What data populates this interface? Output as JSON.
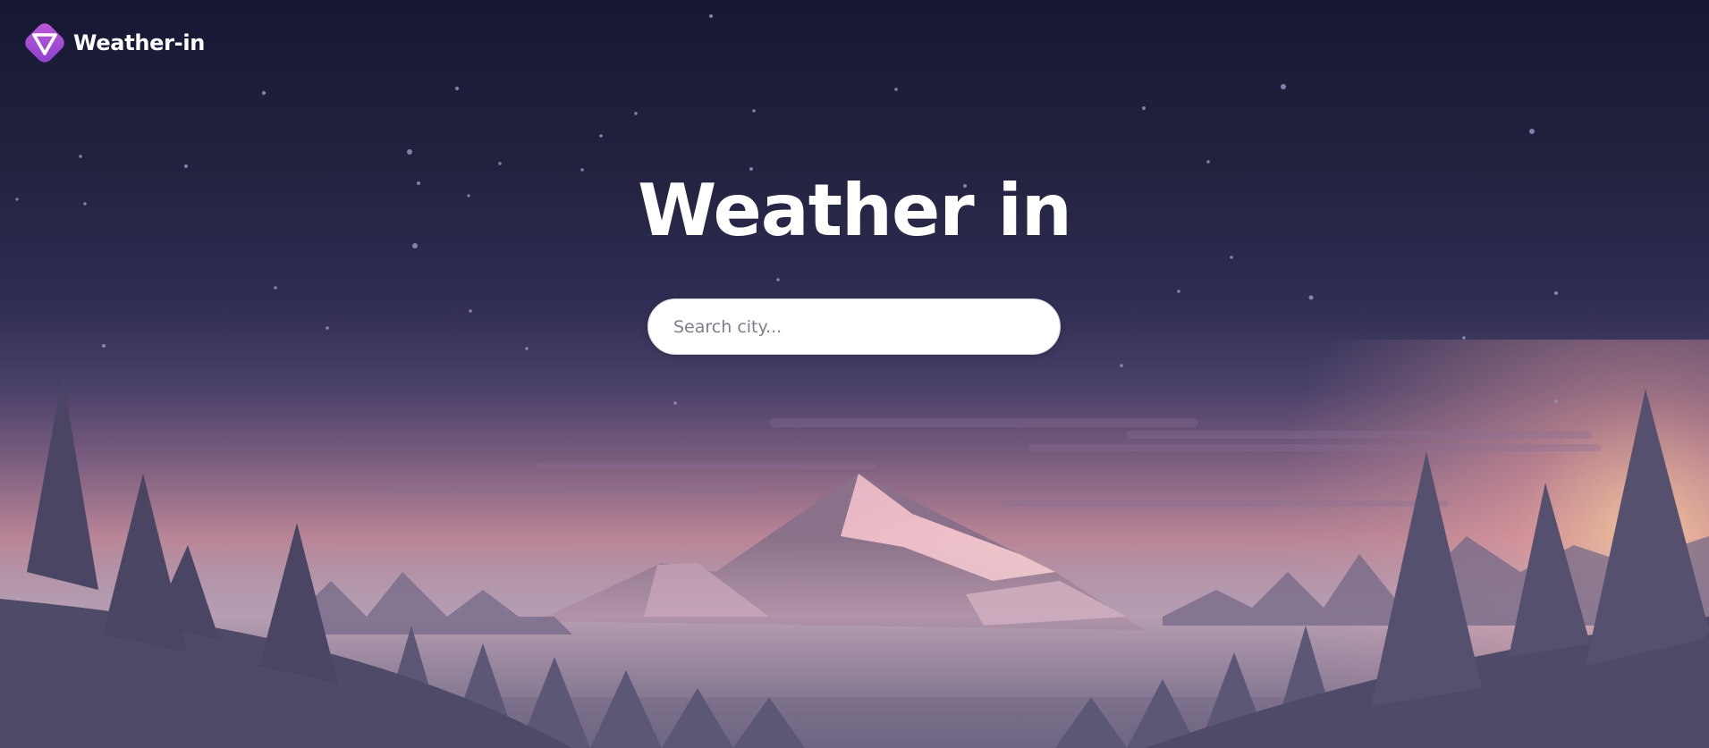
{
  "header": {
    "logo_text": "Weather-in",
    "logo_icon": "triangle-logo-icon"
  },
  "hero": {
    "title": "Weather in",
    "moon_icon": "crescent-moon-icon"
  },
  "search": {
    "placeholder": "Search city...",
    "value": ""
  },
  "colors": {
    "brand_gradient_start": "#c05ad8",
    "brand_gradient_end": "#8a3fd0",
    "sky_top": "#161833",
    "sunset_glow": "#f3c89a"
  },
  "background": {
    "illustration": "mountain-forest-landscape"
  }
}
